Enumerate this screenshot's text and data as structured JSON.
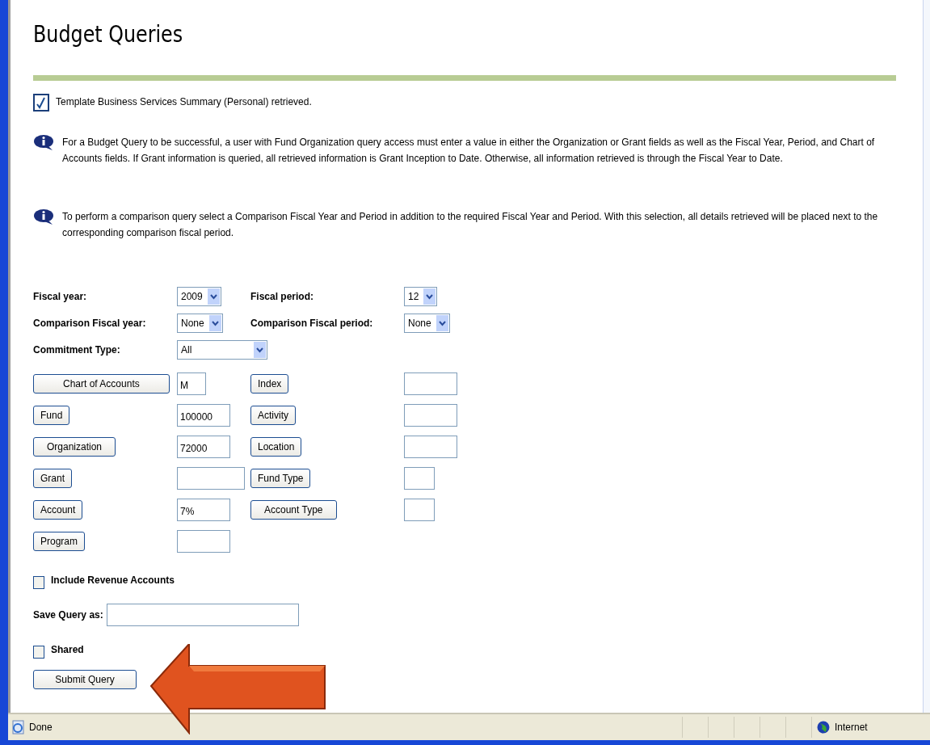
{
  "title": "Budget Queries",
  "messages": [
    {
      "kind": "success",
      "text": "Template Business Services Summary (Personal) retrieved."
    },
    {
      "kind": "info",
      "text": "For a Budget Query to be successful, a user with Fund Organization query access must enter a value in either the Organization or Grant fields as well as the Fiscal Year, Period, and Chart of Accounts fields. If Grant information is queried, all retrieved information is Grant Inception to Date. Otherwise, all information retrieved is through the Fiscal Year to Date."
    },
    {
      "kind": "info",
      "text": "To perform a comparison query select a Comparison Fiscal Year and Period in addition to the required Fiscal Year and Period. With this selection, all details retrieved will be placed next to the corresponding comparison fiscal period."
    }
  ],
  "form_rows": [
    [
      {
        "kind": "label",
        "text": "Fiscal year:"
      },
      {
        "kind": "select",
        "value": "2009"
      },
      {
        "kind": "label",
        "text": "Fiscal period:"
      },
      {
        "kind": "select",
        "value": "12"
      }
    ],
    [
      {
        "kind": "label",
        "text": "Comparison Fiscal year:"
      },
      {
        "kind": "select",
        "value": "None"
      },
      {
        "kind": "label",
        "text": "Comparison Fiscal period:"
      },
      {
        "kind": "select",
        "value": "None"
      }
    ],
    [
      {
        "kind": "label",
        "text": "Commitment Type:"
      },
      {
        "kind": "select",
        "value": "All"
      }
    ],
    [
      {
        "kind": "button",
        "text": "Chart of Accounts"
      },
      {
        "kind": "input",
        "value": "M"
      },
      {
        "kind": "button",
        "text": "Index"
      },
      {
        "kind": "input"
      }
    ],
    [
      {
        "kind": "button",
        "text": "Fund"
      },
      {
        "kind": "input",
        "value": "100000"
      },
      {
        "kind": "button",
        "text": "Activity"
      },
      {
        "kind": "input"
      }
    ],
    [
      {
        "kind": "button",
        "text": "Organization"
      },
      {
        "kind": "input",
        "value": "72000"
      },
      {
        "kind": "button",
        "text": "Location"
      },
      {
        "kind": "input"
      }
    ],
    [
      {
        "kind": "button",
        "text": "Grant"
      },
      {
        "kind": "input"
      },
      {
        "kind": "button",
        "text": "Fund Type"
      },
      {
        "kind": "input"
      }
    ],
    [
      {
        "kind": "button",
        "text": "Account"
      },
      {
        "kind": "input",
        "value": "7%"
      },
      {
        "kind": "button",
        "text": "Account Type"
      },
      {
        "kind": "input"
      }
    ],
    [
      {
        "kind": "button",
        "text": "Program"
      },
      {
        "kind": "input"
      }
    ]
  ],
  "include_revenue": {
    "label": "Include Revenue Accounts",
    "checked": false
  },
  "save_query": {
    "label": "Save Query as:"
  },
  "shared": {
    "label": "Shared",
    "checked": false
  },
  "submit": {
    "label": "Submit Query"
  },
  "status_bar": {
    "text": "Done",
    "zone": "Internet"
  }
}
